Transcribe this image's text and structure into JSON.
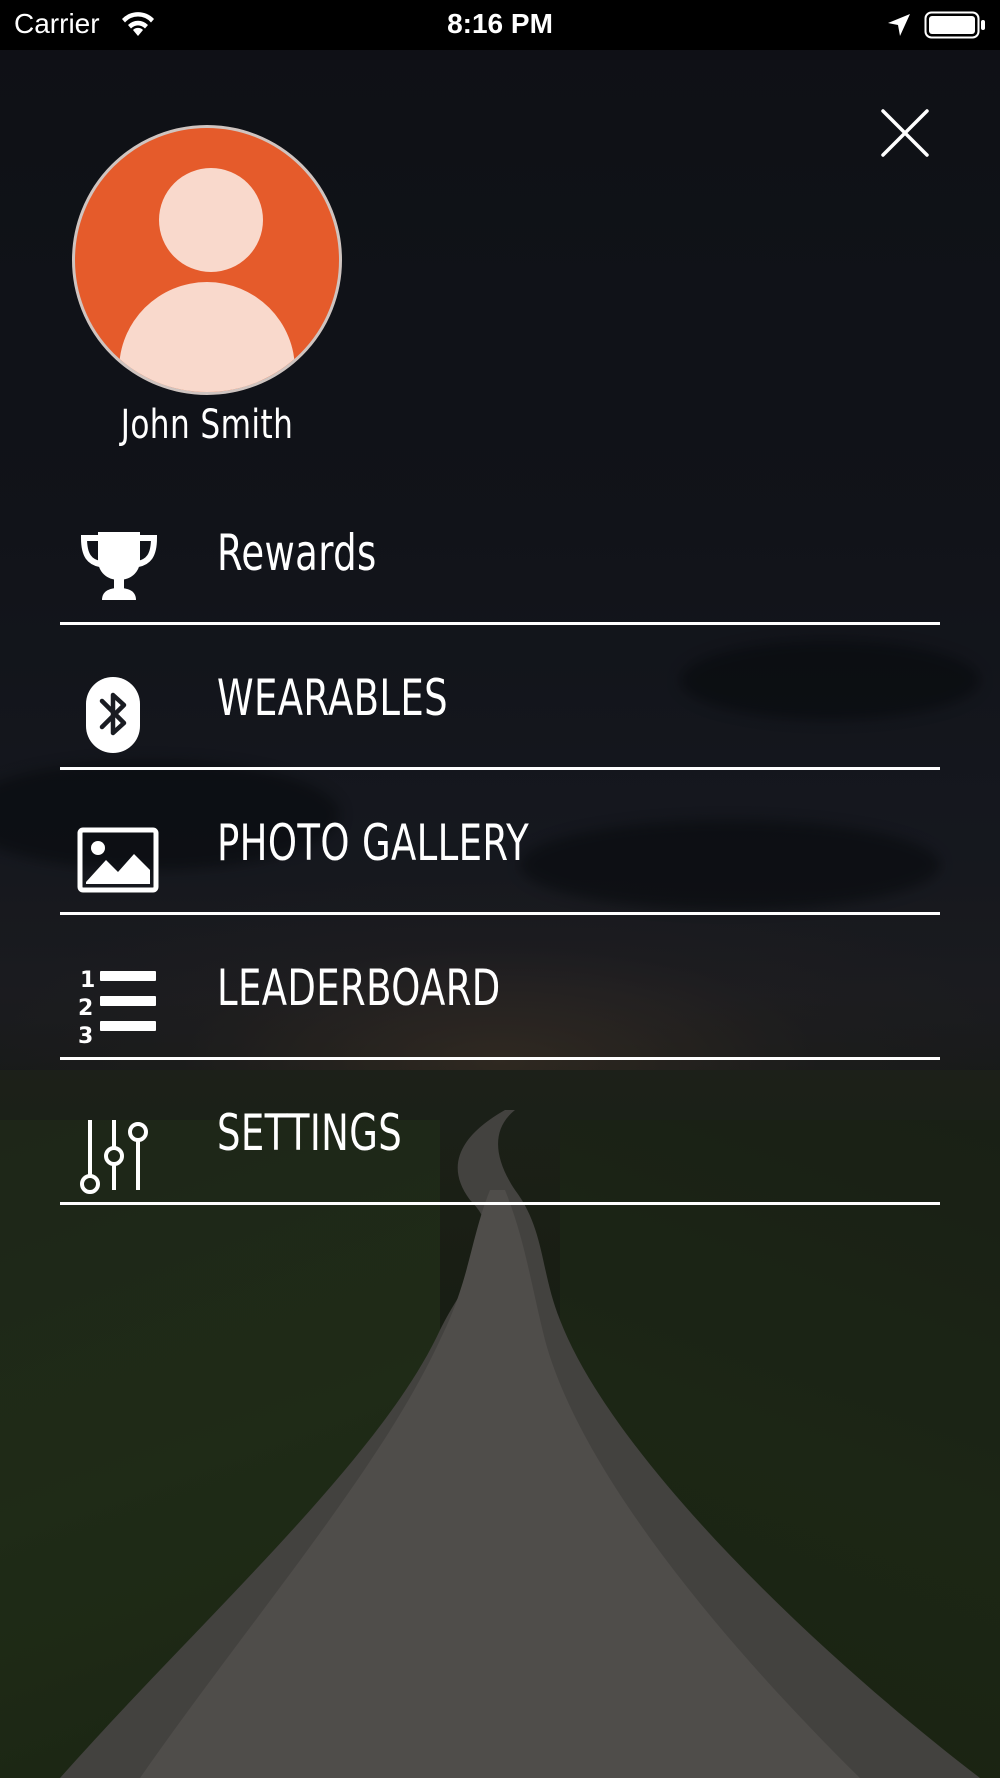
{
  "status_bar": {
    "carrier": "Carrier",
    "time": "8:16 PM"
  },
  "profile": {
    "name": "John Smith"
  },
  "menu": {
    "items": [
      {
        "label": "Rewards",
        "icon": "trophy-icon"
      },
      {
        "label": "WEARABLES",
        "icon": "bluetooth-icon"
      },
      {
        "label": "PHOTO GALLERY",
        "icon": "photo-icon"
      },
      {
        "label": "LEADERBOARD",
        "icon": "numbered-list-icon"
      },
      {
        "label": "SETTINGS",
        "icon": "sliders-icon"
      }
    ]
  },
  "colors": {
    "avatar_bg": "#e55b2b",
    "avatar_fg": "#f9d9cc",
    "text": "#ffffff"
  }
}
